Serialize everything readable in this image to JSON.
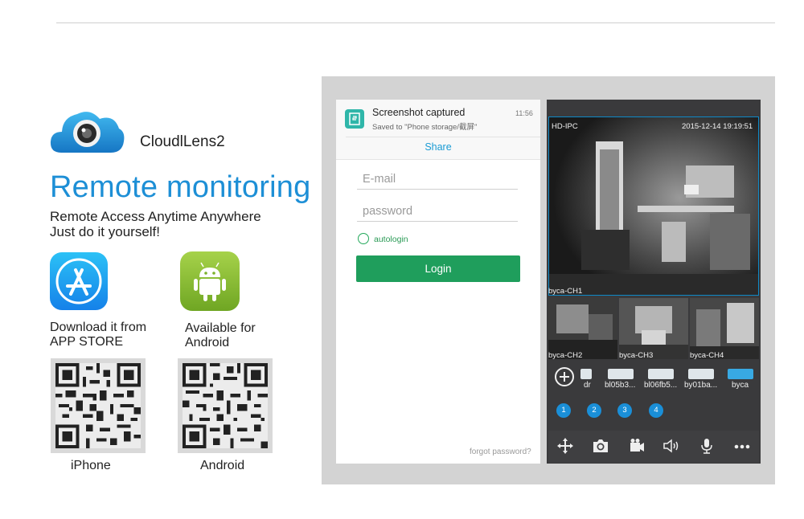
{
  "brand": {
    "name": "CloudlLens2"
  },
  "headline": "Remote monitoring",
  "tagline": {
    "line1": "Remote Access Anytime Anywhere",
    "line2": "Just do it yourself!"
  },
  "downloads": {
    "ios": {
      "line1": "Download it from",
      "line2": "APP STORE",
      "qr_label": "iPhone"
    },
    "android": {
      "line1": "Available for",
      "line2": "Android",
      "qr_label": "Android"
    }
  },
  "login_screen": {
    "notification": {
      "title": "Screenshot captured",
      "subtitle": "Saved to \"Phone storage/截屏\"",
      "time": "11:56",
      "action": "Share"
    },
    "email_placeholder": "E-mail",
    "password_placeholder": "password",
    "autologin_label": "autologin",
    "login_button": "Login",
    "forgot_link": "forgot password?"
  },
  "viewer_screen": {
    "main_camera": {
      "model": "HD-IPC",
      "timestamp": "2015-12-14  19:19:51",
      "channel": "byca-CH1"
    },
    "thumbnails": [
      "byca-CH2",
      "byca-CH3",
      "byca-CH4"
    ],
    "devices": [
      {
        "label": "dr"
      },
      {
        "label": "bl05b3..."
      },
      {
        "label": "bl06fb5..."
      },
      {
        "label": "by01ba..."
      },
      {
        "label": "byca"
      }
    ],
    "channels": [
      "1",
      "2",
      "3",
      "4"
    ],
    "toolbar": [
      "move-icon",
      "camera-icon",
      "record-icon",
      "speaker-icon",
      "microphone-icon",
      "more-icon"
    ]
  },
  "colors": {
    "accent_blue": "#1d8fd6",
    "login_green": "#1f9e5c",
    "channel_blue": "#1a8fd8",
    "dark_bg": "#3a3a3c"
  }
}
